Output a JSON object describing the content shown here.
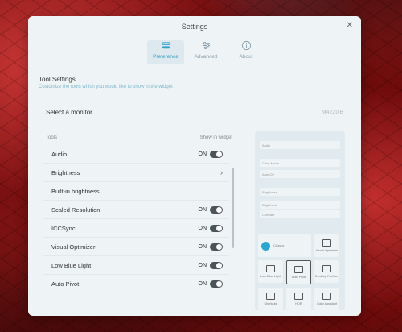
{
  "window": {
    "title": "Settings"
  },
  "tabs": [
    {
      "label": "Preference",
      "icon": "preference-icon",
      "active": true
    },
    {
      "label": "Advanced",
      "icon": "sliders-icon",
      "active": false
    },
    {
      "label": "About",
      "icon": "info-icon",
      "active": false
    }
  ],
  "tool_settings": {
    "title": "Tool Settings",
    "subtitle": "Customize the tools which you would like to show in the widget"
  },
  "monitor": {
    "label": "Select a monitor",
    "value": "M422DB"
  },
  "list": {
    "col_tools": "Tools",
    "col_show": "Show in widget",
    "items": [
      {
        "label": "Audio",
        "state": "ON"
      },
      {
        "label": "Brightness",
        "state": ""
      },
      {
        "label": "Built-in brightness",
        "state": ""
      },
      {
        "label": "Scaled Resolution",
        "state": "ON"
      },
      {
        "label": "ICCSync",
        "state": "ON"
      },
      {
        "label": "Visual Optimizer",
        "state": "ON"
      },
      {
        "label": "Low Blue Light",
        "state": "ON"
      },
      {
        "label": "Auto Pivot",
        "state": "ON"
      }
    ]
  },
  "preview": {
    "rows": [
      "Audio",
      "Color Mode",
      "Auto Off",
      "Brightness",
      "Brightness",
      "Contrast"
    ],
    "tiles": [
      {
        "label": "ICCsync",
        "wide": true
      },
      {
        "label": "Visual Optimizer"
      },
      {
        "label": "Low Blue Light"
      },
      {
        "label": "Auto Pivot",
        "selected": true
      },
      {
        "label": "Desktop Partition"
      },
      {
        "label": "Shortcuts"
      },
      {
        "label": "HDR"
      },
      {
        "label": "Color Assistant"
      }
    ]
  },
  "colors": {
    "accent": "#35a0c8",
    "toggle_on": "#4c545b"
  }
}
